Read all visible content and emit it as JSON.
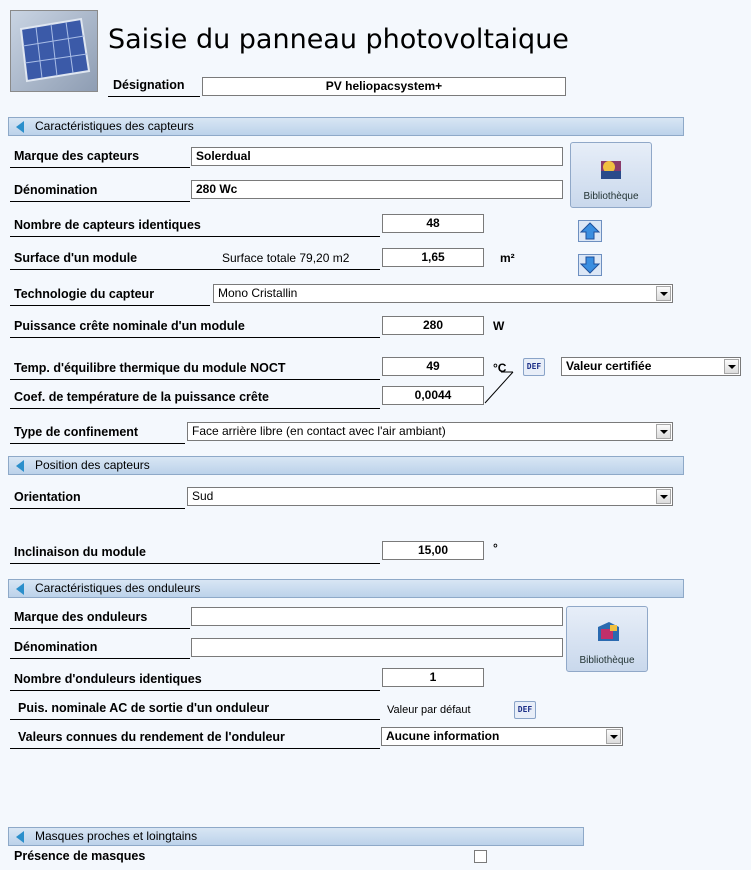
{
  "header": {
    "title": "Saisie du panneau photovoltaique",
    "designation_label": "Désignation",
    "designation_value": "PV heliopacsystem+"
  },
  "sections": {
    "capteurs": "Caractéristiques des capteurs",
    "position": "Position des capteurs",
    "onduleurs": "Caractéristiques des onduleurs",
    "masques": "Masques proches et loingtains"
  },
  "capteurs": {
    "marque_label": "Marque des capteurs",
    "marque_value": "Solerdual",
    "denomination_label": "Dénomination",
    "denomination_value": "280 Wc",
    "library_label": "Bibliothèque",
    "nombre_label": "Nombre de capteurs identiques",
    "nombre_value": "48",
    "surface_label": "Surface d'un module",
    "surface_totale": "Surface totale 79,20 m2",
    "surface_value": "1,65",
    "surface_unit": "m²",
    "techno_label": "Technologie du capteur",
    "techno_value": "Mono Cristallin",
    "puissance_label": "Puissance crête nominale d'un module",
    "puissance_value": "280",
    "puissance_unit": "W",
    "noct_label": "Temp. d'équilibre thermique du module NOCT",
    "noct_value": "49",
    "noct_unit": "°C",
    "def_label": "DEF",
    "noct_select": "Valeur certifiée",
    "coef_label": "Coef. de température de la puissance crête",
    "coef_value": "0,0044",
    "confinement_label": "Type de confinement",
    "confinement_value": "Face arrière libre (en contact avec l'air ambiant)"
  },
  "position": {
    "orientation_label": "Orientation",
    "orientation_value": "Sud",
    "inclinaison_label": "Inclinaison du module",
    "inclinaison_value": "15,00",
    "inclinaison_unit": "°"
  },
  "onduleurs": {
    "marque_label": "Marque des onduleurs",
    "marque_value": "",
    "denomination_label": "Dénomination",
    "denomination_value": "",
    "library_label": "Bibliothèque",
    "nombre_label": "Nombre d'onduleurs identiques",
    "nombre_value": "1",
    "puis_label": "Puis. nominale AC de sortie d'un onduleur",
    "puis_default": "Valeur par défaut",
    "def_label": "DEF",
    "rendement_label": "Valeurs connues du rendement  de l'onduleur",
    "rendement_value": "Aucune information"
  },
  "masques": {
    "presence_label": "Présence de masques",
    "presence_checked": false
  }
}
